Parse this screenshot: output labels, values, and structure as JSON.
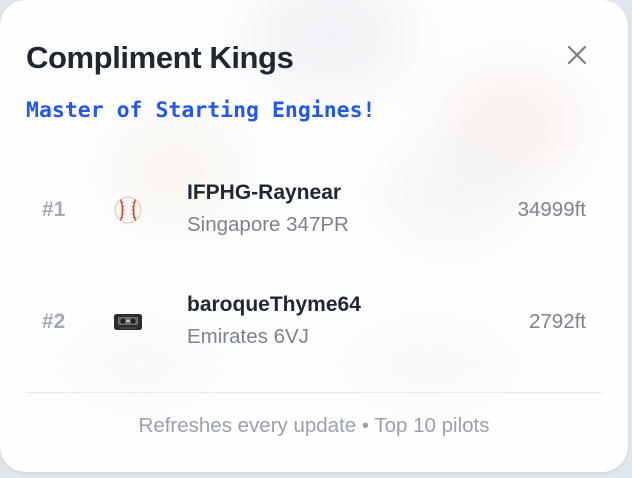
{
  "header": {
    "title": "Compliment Kings",
    "subtitle": "Master of Starting Engines!",
    "close_icon": "close-icon"
  },
  "leaderboard": [
    {
      "rank": "#1",
      "emoji_icon": "baseball-icon",
      "name": "IFPHG-Raynear",
      "flight": "Singapore 347PR",
      "altitude": "34999ft"
    },
    {
      "rank": "#2",
      "emoji_icon": "videocassette-icon",
      "name": "baroqueThyme64",
      "flight": "Emirates 6VJ",
      "altitude": "2792ft"
    }
  ],
  "footer": {
    "text": "Refreshes every update • Top 10 pilots"
  },
  "colors": {
    "title": "#1f2730",
    "subtitle": "#2458e8",
    "muted": "#7c838b",
    "rank": "#a3a9b0"
  }
}
